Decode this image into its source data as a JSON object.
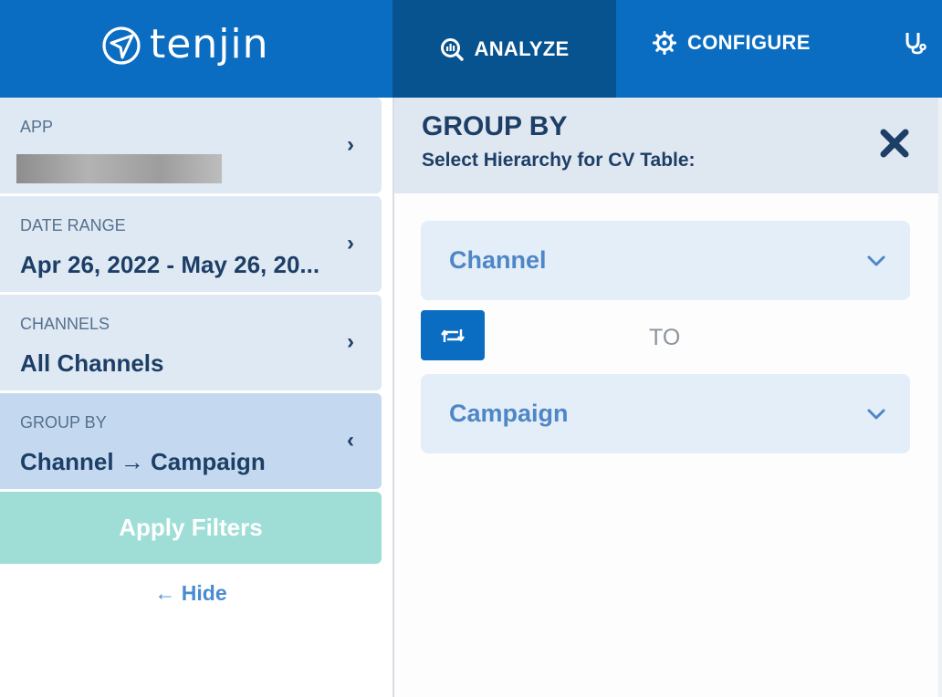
{
  "header": {
    "logo_text": "tenjin",
    "nav": [
      {
        "label": "ANALYZE",
        "icon": "analyze-icon",
        "active": true
      },
      {
        "label": "CONFIGURE",
        "icon": "gear-icon",
        "active": false
      },
      {
        "label": "",
        "icon": "stethoscope-icon",
        "active": false
      }
    ]
  },
  "sidebar": {
    "filters": [
      {
        "label": "APP",
        "value": "",
        "redacted": true,
        "chevron": "›"
      },
      {
        "label": "DATE RANGE",
        "value": "Apr 26, 2022 - May 26, 20...",
        "chevron": "›"
      },
      {
        "label": "CHANNELS",
        "value": "All Channels",
        "chevron": "›"
      },
      {
        "label": "GROUP BY",
        "value": "Channel → Campaign",
        "chevron": "‹"
      }
    ],
    "apply_label": "Apply Filters",
    "hide_label": "← Hide"
  },
  "group_by_panel": {
    "title": "GROUP BY",
    "subtitle": "Select Hierarchy for CV Table:",
    "first_dropdown": "Channel",
    "connector": "TO",
    "second_dropdown": "Campaign"
  },
  "colors": {
    "brand_blue": "#0a6dc2",
    "active_nav": "#07538f",
    "filter_bg": "#dfe9f3",
    "apply_button": "#9fded6"
  }
}
